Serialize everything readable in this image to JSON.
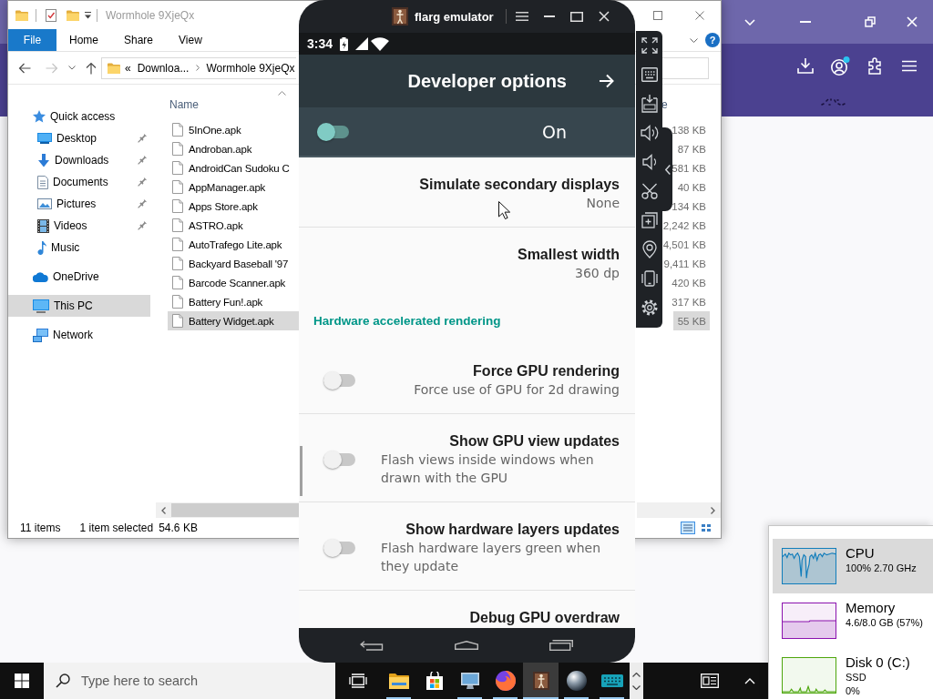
{
  "explorer": {
    "title": "Wormhole 9XjeQx",
    "ribbon": [
      {
        "label": "File",
        "kind": "menu"
      },
      {
        "label": "Home",
        "kind": "tab"
      },
      {
        "label": "Share",
        "kind": "tab"
      },
      {
        "label": "View",
        "kind": "tab"
      }
    ],
    "help_button": "?",
    "address": {
      "overflow": "«",
      "path": [
        "Downloa...",
        "Wormhole 9XjeQx"
      ]
    },
    "nav_pane": [
      {
        "label": "Quick access",
        "selected": false,
        "children": [
          {
            "label": "Desktop",
            "selected": false,
            "pinned": true
          },
          {
            "label": "Downloads",
            "selected": false,
            "pinned": true
          },
          {
            "label": "Documents",
            "selected": false,
            "pinned": true
          },
          {
            "label": "Pictures",
            "selected": false,
            "pinned": true
          },
          {
            "label": "Videos",
            "selected": false,
            "pinned": true
          },
          {
            "label": "Music",
            "selected": false,
            "pinned": false
          }
        ]
      },
      {
        "label": "OneDrive",
        "selected": false
      },
      {
        "label": "This PC",
        "selected": true
      },
      {
        "label": "Network",
        "selected": false
      }
    ],
    "columns": [
      {
        "label": "Name",
        "sorted": true
      },
      {
        "label": "e",
        "sorted": false
      }
    ],
    "files": [
      {
        "name": "5InOne.apk",
        "size": "138 KB",
        "selected": false
      },
      {
        "name": "Androban.apk",
        "size": "87 KB",
        "selected": false
      },
      {
        "name": "AndroidCan Sudoku C",
        "size": "581 KB",
        "selected": false
      },
      {
        "name": "AppManager.apk",
        "size": "40 KB",
        "selected": false
      },
      {
        "name": "Apps Store.apk",
        "size": "134 KB",
        "selected": false
      },
      {
        "name": "ASTRO.apk",
        "size": "2,242 KB",
        "selected": false
      },
      {
        "name": "AutoTrafego Lite.apk",
        "size": "4,501 KB",
        "selected": false
      },
      {
        "name": "Backyard Baseball '97",
        "size": "9,411 KB",
        "selected": false
      },
      {
        "name": "Barcode Scanner.apk",
        "size": "420 KB",
        "selected": false
      },
      {
        "name": "Battery Fun!.apk",
        "size": "317 KB",
        "selected": false
      },
      {
        "name": "Battery Widget.apk",
        "size": "55 KB",
        "selected": true
      }
    ],
    "status_bar": {
      "item_count": "11 items",
      "selection": "1 item selected",
      "selection_size": "54.6 KB",
      "views": [
        {
          "selected": true
        },
        {
          "selected": false
        }
      ]
    }
  },
  "emulator": {
    "title": "flarg emulator",
    "phone": {
      "time": "3:34",
      "title": "Developer options",
      "master_switch": {
        "label": "On",
        "on": true
      },
      "settings": [
        {
          "kind": "setting",
          "title": "Simulate secondary displays",
          "summary": "None"
        },
        {
          "kind": "setting",
          "title": "Smallest width",
          "summary": "360 dp"
        },
        {
          "kind": "category",
          "title": "Hardware accelerated rendering"
        },
        {
          "kind": "switch",
          "title": "Force GPU rendering",
          "summary": "Force use of GPU for 2d drawing",
          "on": false
        },
        {
          "kind": "switch",
          "title": "Show GPU view updates",
          "summary": "Flash views inside windows when drawn with the GPU",
          "on": false
        },
        {
          "kind": "switch",
          "title": "Show hardware layers updates",
          "summary": "Flash hardware layers green when they update",
          "on": false
        },
        {
          "kind": "setting",
          "title": "Debug GPU overdraw"
        }
      ]
    }
  },
  "taskbar": {
    "search": {
      "placeholder": "Type here to search"
    },
    "apps": [
      {
        "running": true,
        "selected": false
      },
      {
        "running": false,
        "selected": false
      },
      {
        "running": true,
        "selected": false
      },
      {
        "running": true,
        "selected": false
      },
      {
        "running": true,
        "selected": true
      },
      {
        "running": true,
        "selected": false
      },
      {
        "running": true,
        "selected": false
      }
    ]
  },
  "task_manager": {
    "resources": [
      {
        "name": "CPU",
        "details": [
          "100% 2.70 GHz"
        ],
        "color": "#117dbb",
        "selected": true
      },
      {
        "name": "Memory",
        "details": [
          "4.6/8.0 GB (57%)"
        ],
        "color": "#8b12ae",
        "selected": false
      },
      {
        "name": "Disk 0 (C:)",
        "details": [
          "SSD",
          "0%"
        ],
        "color": "#4da60c",
        "selected": false
      }
    ]
  }
}
